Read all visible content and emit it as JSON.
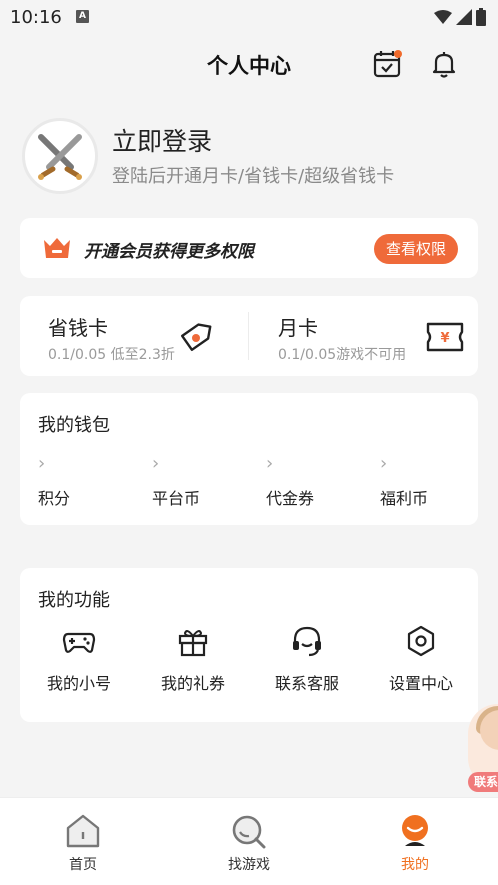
{
  "status_bar": {
    "time": "10:16",
    "notif_letter": "A"
  },
  "header": {
    "title": "个人中心",
    "calendar_icon": "calendar-check-icon",
    "bell_icon": "bell-icon"
  },
  "login": {
    "title": "立即登录",
    "subtitle": "登陆后开通月卡/省钱卡/超级省钱卡"
  },
  "vip": {
    "text": "开通会员获得更多权限",
    "button": "查看权限",
    "accent": "#ef6a3a"
  },
  "cards": {
    "save": {
      "title": "省钱卡",
      "desc": "0.1/0.05 低至2.3折"
    },
    "month": {
      "title": "月卡",
      "desc": "0.1/0.05游戏不可用"
    }
  },
  "wallet": {
    "title": "我的钱包",
    "items": [
      {
        "label": "积分"
      },
      {
        "label": "平台币"
      },
      {
        "label": "代金券"
      },
      {
        "label": "福利币"
      }
    ]
  },
  "functions": {
    "title": "我的功能",
    "items": [
      {
        "label": "我的小号",
        "icon": "gamepad-icon"
      },
      {
        "label": "我的礼券",
        "icon": "gift-icon"
      },
      {
        "label": "联系客服",
        "icon": "headset-icon"
      },
      {
        "label": "设置中心",
        "icon": "settings-hexagon-icon"
      }
    ]
  },
  "float_contact": {
    "label": "联系"
  },
  "tabbar": {
    "items": [
      {
        "label": "首页",
        "icon": "home-icon"
      },
      {
        "label": "找游戏",
        "icon": "search-icon"
      },
      {
        "label": "我的",
        "icon": "mascot-icon"
      }
    ],
    "active_color": "#f07020"
  }
}
